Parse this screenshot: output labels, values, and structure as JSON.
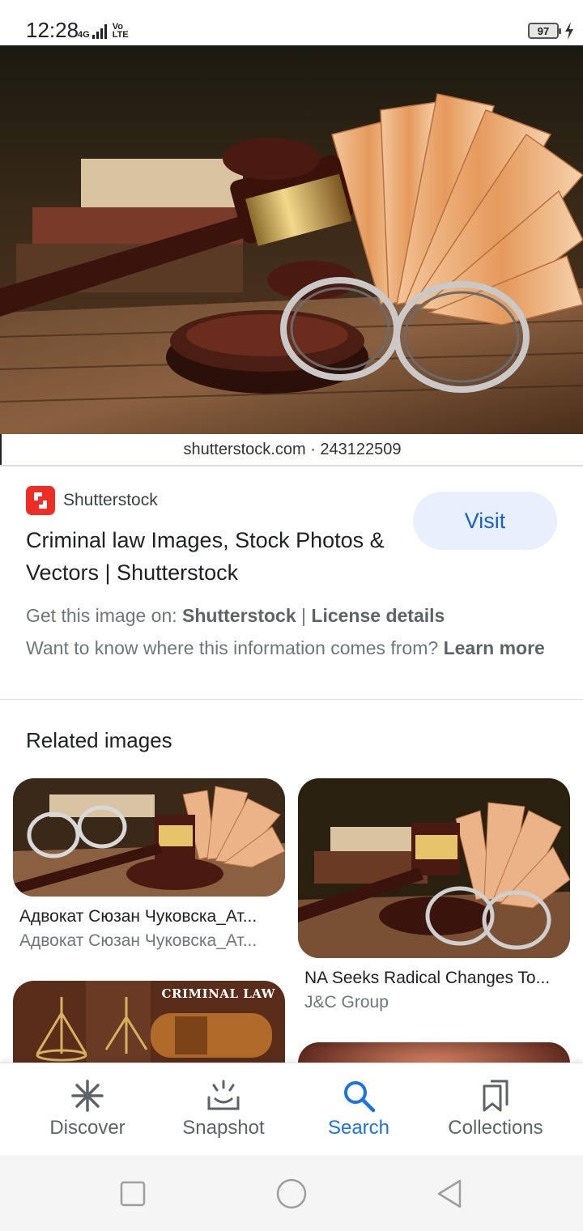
{
  "status": {
    "time": "12:28",
    "network": "4G",
    "volte_top": "Vo",
    "volte_bottom": "LTE",
    "battery": "97"
  },
  "hero": {
    "watermark": "shutterstock.com · 243122509"
  },
  "source": {
    "name": "Shutterstock",
    "logo_color": "#ee2e24",
    "visit_label": "Visit",
    "title": "Criminal law Images, Stock Photos & Vectors | Shutterstock",
    "get_prefix": "Get this image on:",
    "get_source": "Shutterstock",
    "separator": "|",
    "license": "License details",
    "info_question": "Want to know where this information comes from?",
    "learn_more": "Learn more"
  },
  "related": {
    "heading": "Related images",
    "cards": [
      {
        "title": "Адвокат Сюзан Чуковска_Ат...",
        "source": "Адвокат Сюзан Чуковска_Ат..."
      },
      {
        "title": "NA Seeks Radical Changes To...",
        "source": "J&C Group"
      },
      {
        "title": "",
        "source": "",
        "overlay": "CRIMINAL LAW"
      },
      {
        "title": "",
        "source": ""
      }
    ]
  },
  "bottom_nav": {
    "items": [
      {
        "label": "Discover",
        "icon": "asterisk-icon",
        "active": false
      },
      {
        "label": "Snapshot",
        "icon": "snapshot-icon",
        "active": false
      },
      {
        "label": "Search",
        "icon": "search-icon",
        "active": true
      },
      {
        "label": "Collections",
        "icon": "bookmarks-icon",
        "active": false
      }
    ],
    "active_color": "#1a73e8"
  },
  "system_nav": {
    "buttons": [
      "recents-icon",
      "home-icon",
      "back-icon"
    ]
  }
}
